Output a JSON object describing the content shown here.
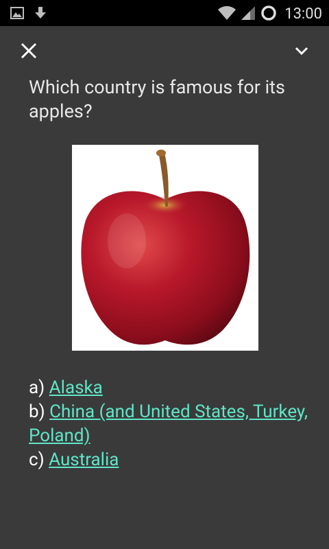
{
  "status_bar": {
    "time": "13:00",
    "icons": [
      "image-notification-icon",
      "download-icon",
      "wifi-icon",
      "signal-icon",
      "sync-icon"
    ]
  },
  "top_bar": {
    "close_icon": "close-icon",
    "collapse_icon": "chevron-down-icon"
  },
  "question": {
    "text": "Which country is famous for its apples?"
  },
  "image": {
    "subject": "apple"
  },
  "answers": [
    {
      "prefix": "a)",
      "label": "Alaska"
    },
    {
      "prefix": "b)",
      "label": "China (and United States, Turkey, Poland)"
    },
    {
      "prefix": "c)",
      "label": "Australia"
    }
  ],
  "colors": {
    "background": "#3a3a3a",
    "status_bar": "#000000",
    "link": "#5fe6c8",
    "text": "#e8e8e8"
  }
}
